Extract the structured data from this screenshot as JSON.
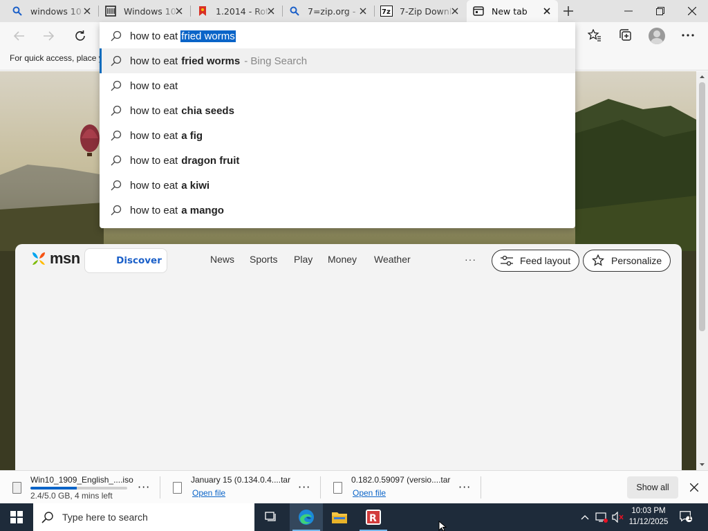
{
  "browser": {
    "tabs": [
      {
        "label": "windows 10",
        "icon": "search-icon"
      },
      {
        "label": "Windows 10",
        "icon": "library-icon"
      },
      {
        "label": "1.2014 - Rot",
        "icon": "red-bookmark-icon"
      },
      {
        "label": "7=zip.org - ",
        "icon": "search-icon"
      },
      {
        "label": "7-Zip Downl",
        "icon": "7zip-icon"
      },
      {
        "label": "New tab",
        "icon": "newtab-icon",
        "active": true
      }
    ],
    "favorites_bar_text": "For quick access, place y"
  },
  "omnibox": {
    "typed": "how to eat",
    "autocomplete": "fried worms"
  },
  "suggestions": [
    {
      "prefix": "how to eat",
      "bold": "fried worms",
      "suffix": "- Bing Search",
      "selected": true
    },
    {
      "prefix": "how to eat",
      "bold": "",
      "suffix": ""
    },
    {
      "prefix": "how to eat",
      "bold": "chia seeds",
      "suffix": ""
    },
    {
      "prefix": "how to eat",
      "bold": "a fig",
      "suffix": ""
    },
    {
      "prefix": "how to eat",
      "bold": "dragon fruit",
      "suffix": ""
    },
    {
      "prefix": "how to eat",
      "bold": "a kiwi",
      "suffix": ""
    },
    {
      "prefix": "how to eat",
      "bold": "a mango",
      "suffix": ""
    }
  ],
  "msn": {
    "logo": "msn",
    "discover": "Discover",
    "nav": [
      "News",
      "Sports",
      "Play",
      "Money",
      "Weather"
    ],
    "more": "···",
    "feed_layout": "Feed layout",
    "personalize": "Personalize"
  },
  "downloads": {
    "items": [
      {
        "name": "Win10_1909_English_....iso",
        "status": "2.4/5.0 GB, 4 mins left",
        "progress": 0.48
      },
      {
        "name": "January 15 (0.134.0.4....tar",
        "action": "Open file"
      },
      {
        "name": "0.182.0.59097 (versio....tar",
        "action": "Open file"
      }
    ],
    "show_all": "Show all"
  },
  "taskbar": {
    "search_placeholder": "Type here to search",
    "time": "10:03 PM",
    "date": "11/12/2025",
    "notification_count": "1"
  },
  "colors": {
    "accent": "#0a64c8",
    "taskbar": "#1e2b3a"
  }
}
